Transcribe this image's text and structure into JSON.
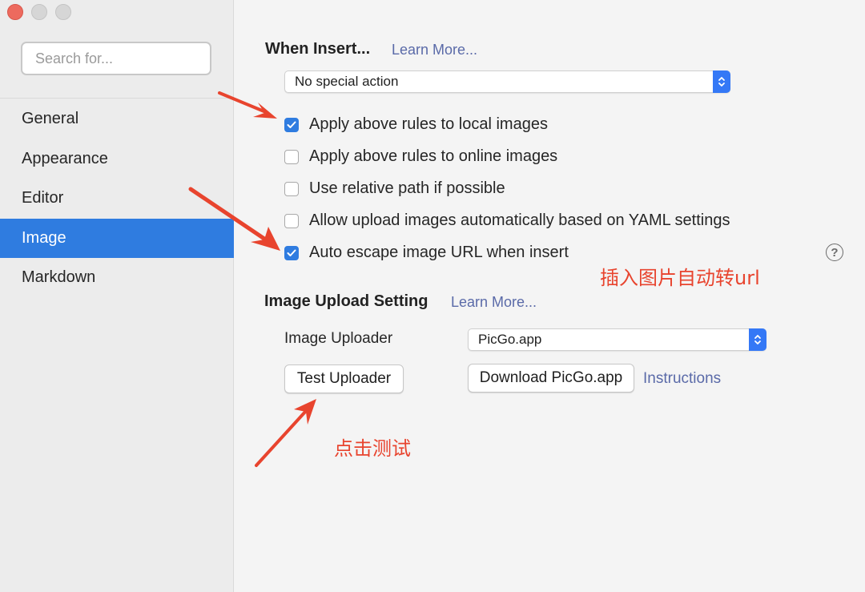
{
  "sidebar": {
    "search_placeholder": "Search for...",
    "items": [
      {
        "label": "General"
      },
      {
        "label": "Appearance"
      },
      {
        "label": "Editor"
      },
      {
        "label": "Image",
        "active": true
      },
      {
        "label": "Markdown"
      }
    ]
  },
  "when_insert": {
    "title": "When Insert...",
    "learn_more": "Learn More...",
    "action_select": "No special action",
    "options": [
      {
        "label": "Apply above rules to local images",
        "checked": true
      },
      {
        "label": "Apply above rules to online images",
        "checked": false
      },
      {
        "label": "Use relative path if possible",
        "checked": false
      },
      {
        "label": "Allow upload images automatically based on YAML settings",
        "checked": false
      },
      {
        "label": "Auto escape image URL when insert",
        "checked": true
      }
    ],
    "help_symbol": "?"
  },
  "upload": {
    "title": "Image Upload Setting",
    "learn_more": "Learn More...",
    "uploader_label": "Image Uploader",
    "uploader_value": "PicGo.app",
    "test_button": "Test Uploader",
    "download_button": "Download PicGo.app",
    "instructions_link": "Instructions"
  },
  "annotations": {
    "auto_escape_note": "插入图片自动转url",
    "test_note": "点击测试",
    "color": "#e8442e"
  },
  "colors": {
    "accent": "#2f7ce0",
    "link": "#5a6aa8",
    "window_close": "#ed6a5e"
  }
}
